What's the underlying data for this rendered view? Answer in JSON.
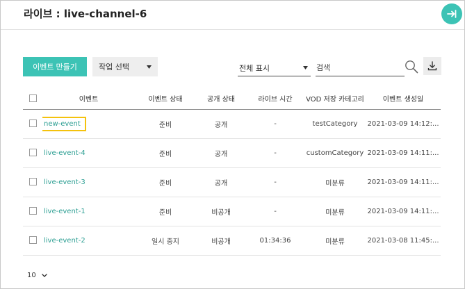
{
  "header": {
    "title": "라이브 : live-channel-6"
  },
  "toolbar": {
    "create_label": "이벤트 만들기",
    "action_select_label": "작업 선택",
    "filter_label": "전체 표시",
    "search_placeholder": "검색"
  },
  "table": {
    "columns": [
      "이벤트",
      "이벤트 상태",
      "공개 상태",
      "라이브 시간",
      "VOD 저장 카테고리",
      "이벤트 생성일"
    ],
    "rows": [
      {
        "name": "new-event",
        "status": "준비",
        "visibility": "공개",
        "live_time": "-",
        "category": "testCategory",
        "created": "2021-03-09 14:12:..."
      },
      {
        "name": "live-event-4",
        "status": "준비",
        "visibility": "공개",
        "live_time": "-",
        "category": "customCategory",
        "created": "2021-03-09 14:11:..."
      },
      {
        "name": "live-event-3",
        "status": "준비",
        "visibility": "공개",
        "live_time": "-",
        "category": "미분류",
        "created": "2021-03-09 14:11:..."
      },
      {
        "name": "live-event-1",
        "status": "준비",
        "visibility": "비공개",
        "live_time": "-",
        "category": "미분류",
        "created": "2021-03-09 14:11:..."
      },
      {
        "name": "live-event-2",
        "status": "일시 중지",
        "visibility": "비공개",
        "live_time": "01:34:36",
        "category": "미분류",
        "created": "2021-03-08 11:45:..."
      }
    ]
  },
  "pagination": {
    "page_size": "10"
  },
  "colors": {
    "accent": "#3cc3b5",
    "link": "#2b9e92",
    "highlight": "#f4c20d"
  },
  "icons": [
    "exit-icon",
    "chevron-down-icon",
    "search-icon",
    "download-icon"
  ]
}
